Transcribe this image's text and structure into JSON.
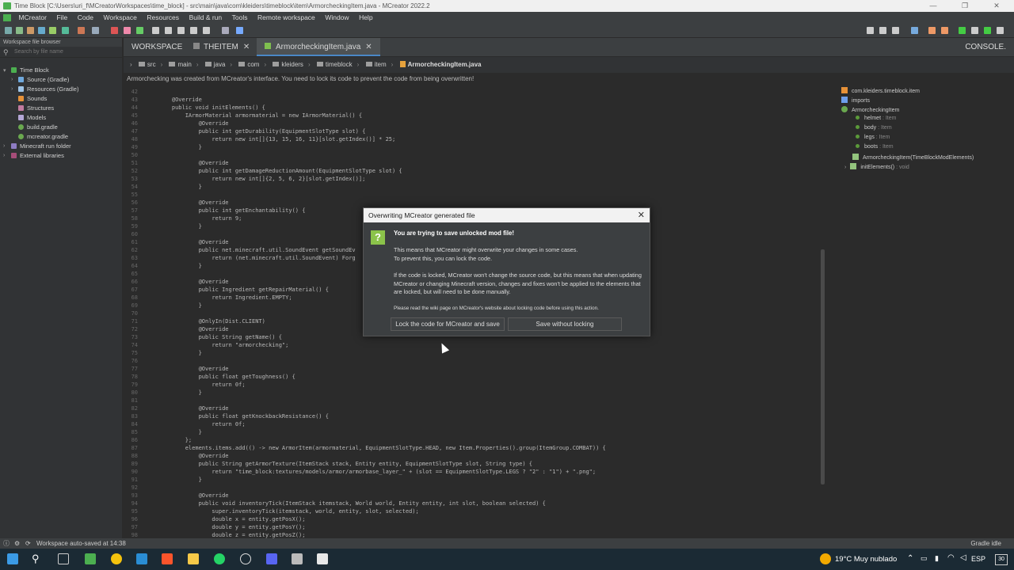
{
  "window": {
    "title": "Time Block [C:\\Users\\uri_f\\MCreatorWorkspaces\\time_block] - src\\main\\java\\com\\kleiders\\timeblock\\item\\ArmorcheckingItem.java - MCreator 2022.2",
    "controls": [
      "—",
      "❐",
      "✕"
    ]
  },
  "menu": [
    "MCreator",
    "File",
    "Code",
    "Workspace",
    "Resources",
    "Build & run",
    "Tools",
    "Remote workspace",
    "Window",
    "Help"
  ],
  "sidebar": {
    "header": "Workspace file browser",
    "search_placeholder": "Search by file name",
    "items": [
      {
        "label": "Time Block"
      },
      {
        "label": "Source (Gradle)"
      },
      {
        "label": "Resources (Gradle)"
      },
      {
        "label": "Sounds"
      },
      {
        "label": "Structures"
      },
      {
        "label": "Models"
      },
      {
        "label": "build.gradle"
      },
      {
        "label": "mcreator.gradle"
      },
      {
        "label": "Minecraft run folder"
      },
      {
        "label": "External libraries"
      }
    ]
  },
  "tabs": {
    "workspace": "WORKSPACE",
    "theitem": "THEITEM",
    "file": "ArmorcheckingItem.java",
    "console": "CONSOLE."
  },
  "breadcrumb": [
    "src",
    "main",
    "java",
    "com",
    "kleiders",
    "timeblock",
    "item",
    "ArmorcheckingItem.java"
  ],
  "notice": "Armorchecking was created from MCreator's interface. You need to lock its code to prevent the code from being overwritten!",
  "code": {
    "lines": [
      {
        "n": "42",
        "t": ""
      },
      {
        "n": "43",
        "t": "    @Override"
      },
      {
        "n": "44",
        "t": "    public void initElements() {"
      },
      {
        "n": "45",
        "t": "        IArmorMaterial armormaterial = new IArmorMaterial() {"
      },
      {
        "n": "46",
        "t": "            @Override"
      },
      {
        "n": "47",
        "t": "            public int getDurability(EquipmentSlotType slot) {"
      },
      {
        "n": "48",
        "t": "                return new int[]{13, 15, 16, 11}[slot.getIndex()] * 25;"
      },
      {
        "n": "49",
        "t": "            }"
      },
      {
        "n": "50",
        "t": ""
      },
      {
        "n": "51",
        "t": "            @Override"
      },
      {
        "n": "52",
        "t": "            public int getDamageReductionAmount(EquipmentSlotType slot) {"
      },
      {
        "n": "53",
        "t": "                return new int[]{2, 5, 6, 2}[slot.getIndex()];"
      },
      {
        "n": "54",
        "t": "            }"
      },
      {
        "n": "55",
        "t": ""
      },
      {
        "n": "56",
        "t": "            @Override"
      },
      {
        "n": "57",
        "t": "            public int getEnchantability() {"
      },
      {
        "n": "58",
        "t": "                return 9;"
      },
      {
        "n": "59",
        "t": "            }"
      },
      {
        "n": "60",
        "t": ""
      },
      {
        "n": "61",
        "t": "            @Override"
      },
      {
        "n": "62",
        "t": "            public net.minecraft.util.SoundEvent getSoundEv"
      },
      {
        "n": "63",
        "t": "                return (net.minecraft.util.SoundEvent) Forg"
      },
      {
        "n": "64",
        "t": "            }"
      },
      {
        "n": "65",
        "t": ""
      },
      {
        "n": "66",
        "t": "            @Override"
      },
      {
        "n": "67",
        "t": "            public Ingredient getRepairMaterial() {"
      },
      {
        "n": "68",
        "t": "                return Ingredient.EMPTY;"
      },
      {
        "n": "69",
        "t": "            }"
      },
      {
        "n": "70",
        "t": ""
      },
      {
        "n": "71",
        "t": "            @OnlyIn(Dist.CLIENT)"
      },
      {
        "n": "72",
        "t": "            @Override"
      },
      {
        "n": "73",
        "t": "            public String getName() {"
      },
      {
        "n": "74",
        "t": "                return \"armorchecking\";"
      },
      {
        "n": "75",
        "t": "            }"
      },
      {
        "n": "76",
        "t": ""
      },
      {
        "n": "77",
        "t": "            @Override"
      },
      {
        "n": "78",
        "t": "            public float getToughness() {"
      },
      {
        "n": "79",
        "t": "                return 0f;"
      },
      {
        "n": "80",
        "t": "            }"
      },
      {
        "n": "81",
        "t": ""
      },
      {
        "n": "82",
        "t": "            @Override"
      },
      {
        "n": "83",
        "t": "            public float getKnockbackResistance() {"
      },
      {
        "n": "84",
        "t": "                return 0f;"
      },
      {
        "n": "85",
        "t": "            }"
      },
      {
        "n": "86",
        "t": "        };"
      },
      {
        "n": "87",
        "t": "        elements.items.add(() -> new ArmorItem(armormaterial, EquipmentSlotType.HEAD, new Item.Properties().group(ItemGroup.COMBAT)) {"
      },
      {
        "n": "88",
        "t": "            @Override"
      },
      {
        "n": "89",
        "t": "            public String getArmorTexture(ItemStack stack, Entity entity, EquipmentSlotType slot, String type) {"
      },
      {
        "n": "90",
        "t": "                return \"time_block:textures/models/armor/armorbase_layer_\" + (slot == EquipmentSlotType.LEGS ? \"2\" : \"1\") + \".png\";"
      },
      {
        "n": "91",
        "t": "            }"
      },
      {
        "n": "92",
        "t": ""
      },
      {
        "n": "93",
        "t": "            @Override"
      },
      {
        "n": "94",
        "t": "            public void inventoryTick(ItemStack itemstack, World world, Entity entity, int slot, boolean selected) {"
      },
      {
        "n": "95",
        "t": "                super.inventoryTick(itemstack, world, entity, slot, selected);"
      },
      {
        "n": "96",
        "t": "                double x = entity.getPosX();"
      },
      {
        "n": "97",
        "t": "                double y = entity.getPosY();"
      },
      {
        "n": "98",
        "t": "                double z = entity.getPosZ();"
      }
    ]
  },
  "outline": {
    "package": "com.kleiders.timeblock.item",
    "imports": "imports",
    "class": "ArmorcheckingItem",
    "fields": [
      {
        "name": "helmet",
        "type": ": Item"
      },
      {
        "name": "body",
        "type": ": Item"
      },
      {
        "name": "legs",
        "type": ": Item"
      },
      {
        "name": "boots",
        "type": ": Item"
      }
    ],
    "ctor": "ArmorcheckingItem(TimeBlockModElements)",
    "method": "initElements()",
    "method_type": ": void"
  },
  "dialog": {
    "title": "Overwriting MCreator generated file",
    "heading": "You are trying to save unlocked mod file!",
    "p1a": "This means that MCreator might overwrite your changes in some cases.",
    "p1b": "To prevent this, you can lock the code.",
    "p2": "If the code is locked, MCreator won't change the source code, but this means that when updating MCreator or changing Minecraft version, changes and fixes won't be applied to the elements that are locked, but will need to be done manually.",
    "p3": "Please read the wiki page on MCreator's website about locking code before using this action.",
    "btn_lock": "Lock the code for MCreator and save",
    "btn_save": "Save without locking"
  },
  "status": {
    "left": "Workspace auto-saved at 14:38",
    "right": "Gradle idle"
  },
  "taskbar": {
    "weather": "19°C  Muy nublado",
    "lang": "ESP",
    "badge": "30"
  }
}
